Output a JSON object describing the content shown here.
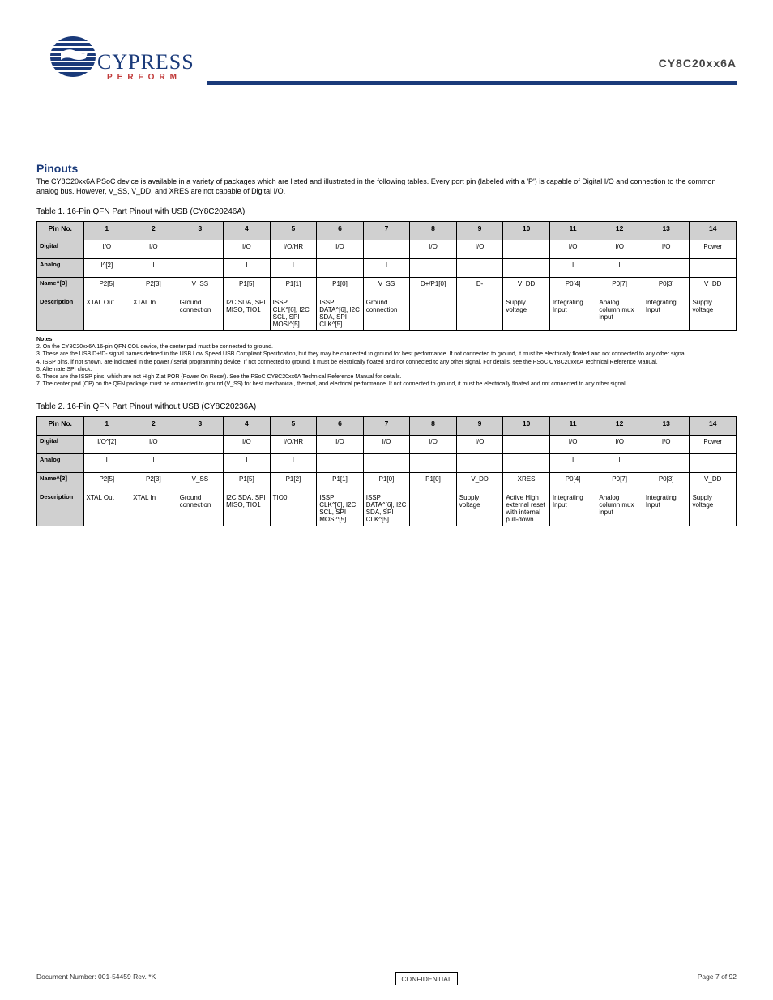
{
  "header": {
    "brand": "CYPRESS",
    "tagline": "PERFORM",
    "part": "CY8C20xx6A"
  },
  "section": {
    "title": "Pinouts",
    "sub": "The CY8C20xx6A PSoC device is available in a variety of packages which are listed and illustrated in the following tables. Every port pin (labeled with a 'P') is capable of Digital I/O and connection to the common analog bus. However, V_SS, V_DD, and XRES are not capable of Digital I/O."
  },
  "tables": [
    {
      "idx": 1,
      "caption": "Table 1.  16-Pin QFN Part Pinout with USB (CY8C20246A)",
      "cols": [
        "Pin No.",
        "1",
        "2",
        "3",
        "4",
        "5",
        "6",
        "7",
        "8",
        "9",
        "10",
        "11",
        "12",
        "13",
        "14"
      ],
      "rows": [
        {
          "hdr": "Digital",
          "cells": [
            "I/O",
            "I/O",
            "",
            "I/O",
            "I/O/HR",
            "I/O",
            "",
            "I/O",
            "I/O",
            "",
            "I/O",
            "I/O",
            "I/O",
            "Power"
          ]
        },
        {
          "hdr": "Analog",
          "cells": [
            "I^[2]",
            "I",
            "",
            "I",
            "I",
            "I",
            "I",
            "",
            "",
            "",
            "I",
            "I",
            "",
            ""
          ]
        },
        {
          "hdr": "Name^[3]",
          "cells": [
            "P2[5]",
            "P2[3]",
            "V_SS",
            "P1[5]",
            "P1[1]",
            "P1[0]",
            "V_SS",
            "D+/P1[0]",
            "D-",
            "V_DD",
            "P0[4]",
            "P0[7]",
            "P0[3]",
            "V_DD"
          ]
        },
        {
          "hdr": "Description",
          "left": true,
          "cells": [
            "XTAL Out",
            "XTAL In",
            "Ground connection",
            "I2C SDA, SPI MISO, TIO1",
            "ISSP CLK^[6], I2C SCL, SPI MOSI^[5]",
            "ISSP DATA^[6], I2C SDA, SPI CLK^[5]",
            "Ground connection",
            "",
            "",
            "Supply voltage",
            "Integrating Input",
            "Analog column mux input",
            "Integrating Input",
            "Supply voltage"
          ]
        }
      ],
      "footnotes": [
        "2. On the CY8C20xx6A 16-pin QFN COL device, the center pad must be connected to ground.",
        "3. These are the USB D+/D- signal names defined in the USB Low Speed USB Compliant Specification, but they may be connected to ground for best performance. If not connected to ground, it must be electrically floated and not connected to any other signal.",
        "4. ISSP pins, if not shown, are indicated in the power / serial programming device. If not connected to ground, it must be electrically floated and not connected to any other signal. For details, see the PSoC CY8C20xx6A Technical Reference Manual.",
        "5. Alternate SPI clock.",
        "6. These are the ISSP pins, which are not High Z at POR (Power On Reset). See the PSoC CY8C20xx6A Technical Reference Manual for details.",
        "7. The center pad (CP) on the QFN package must be connected to ground (V_SS) for best mechanical, thermal, and electrical performance. If not connected to ground, it must be electrically floated and not connected to any other signal."
      ]
    },
    {
      "idx": 2,
      "caption": "Table 2.  16-Pin QFN Part Pinout without USB (CY8C20236A)",
      "cols": [
        "Pin No.",
        "1",
        "2",
        "3",
        "4",
        "5",
        "6",
        "7",
        "8",
        "9",
        "10",
        "11",
        "12",
        "13",
        "14"
      ],
      "rows": [
        {
          "hdr": "Digital",
          "cells": [
            "I/O^[2]",
            "I/O",
            "",
            "I/O",
            "I/O/HR",
            "I/O",
            "I/O",
            "I/O",
            "I/O",
            "",
            "I/O",
            "I/O",
            "I/O",
            "Power"
          ]
        },
        {
          "hdr": "Analog",
          "cells": [
            "I",
            "I",
            "",
            "I",
            "I",
            "I",
            "",
            "",
            "",
            "",
            "I",
            "I",
            "",
            ""
          ]
        },
        {
          "hdr": "Name^[3]",
          "cells": [
            "P2[5]",
            "P2[3]",
            "V_SS",
            "P1[5]",
            "P1[2]",
            "P1[1]",
            "P1[0]",
            "P1[0]",
            "V_DD",
            "XRES",
            "P0[4]",
            "P0[7]",
            "P0[3]",
            "V_DD"
          ]
        },
        {
          "hdr": "Description",
          "left": true,
          "cells": [
            "XTAL Out",
            "XTAL In",
            "Ground connection",
            "I2C SDA, SPI MISO, TIO1",
            "TIO0",
            "ISSP CLK^[6], I2C SCL, SPI MOSI^[5]",
            "ISSP DATA^[6], I2C SDA, SPI CLK^[5]",
            "",
            "Supply voltage",
            "Active High external reset with internal pull-down",
            "Integrating Input",
            "Analog column mux input",
            "Integrating Input",
            "Supply voltage"
          ]
        }
      ]
    }
  ],
  "chart_data": [
    {
      "type": "table",
      "title": "16-Pin QFN Part Pinout with USB (CY8C20246A)",
      "columns": [
        "Pin No.",
        "Digital",
        "Analog",
        "Name",
        "Description"
      ],
      "rows": [
        [
          "1",
          "I/O",
          "I",
          "P2[5]",
          "XTAL Out"
        ],
        [
          "2",
          "I/O",
          "I",
          "P2[3]",
          "XTAL In"
        ],
        [
          "3",
          "",
          "",
          "V_SS",
          "Ground connection"
        ],
        [
          "4",
          "I/O",
          "I",
          "P1[5]",
          "I2C SDA, SPI MISO, TIO1"
        ],
        [
          "5",
          "I/O/HR",
          "I",
          "P1[1]",
          "ISSP CLK, I2C SCL, SPI MOSI"
        ],
        [
          "6",
          "I/O",
          "I",
          "P1[0]",
          "ISSP DATA, I2C SDA, SPI CLK"
        ],
        [
          "7",
          "",
          "I",
          "V_SS",
          "Ground connection"
        ],
        [
          "8",
          "I/O",
          "",
          "D+/P1[0]",
          ""
        ],
        [
          "9",
          "I/O",
          "",
          "D-",
          ""
        ],
        [
          "10",
          "",
          "",
          "V_DD",
          "Supply voltage"
        ],
        [
          "11",
          "I/O",
          "I",
          "P0[4]",
          "Integrating Input"
        ],
        [
          "12",
          "I/O",
          "I",
          "P0[7]",
          "Analog column mux input"
        ],
        [
          "13",
          "I/O",
          "",
          "P0[3]",
          "Integrating Input"
        ],
        [
          "14",
          "Power",
          "",
          "V_DD",
          "Supply voltage"
        ]
      ]
    },
    {
      "type": "table",
      "title": "16-Pin QFN Part Pinout without USB (CY8C20236A)",
      "columns": [
        "Pin No.",
        "Digital",
        "Analog",
        "Name",
        "Description"
      ],
      "rows": [
        [
          "1",
          "I/O",
          "I",
          "P2[5]",
          "XTAL Out"
        ],
        [
          "2",
          "I/O",
          "I",
          "P2[3]",
          "XTAL In"
        ],
        [
          "3",
          "",
          "",
          "V_SS",
          "Ground connection"
        ],
        [
          "4",
          "I/O",
          "I",
          "P1[5]",
          "I2C SDA, SPI MISO, TIO1"
        ],
        [
          "5",
          "I/O/HR",
          "I",
          "P1[2]",
          "TIO0"
        ],
        [
          "6",
          "I/O",
          "I",
          "P1[1]",
          "ISSP CLK, I2C SCL, SPI MOSI"
        ],
        [
          "7",
          "I/O",
          "",
          "P1[0]",
          "ISSP DATA, I2C SDA, SPI CLK"
        ],
        [
          "8",
          "I/O",
          "",
          "P1[0]",
          ""
        ],
        [
          "9",
          "I/O",
          "",
          "V_DD",
          "Supply voltage"
        ],
        [
          "10",
          "",
          "",
          "XRES",
          "Active High external reset with internal pull-down"
        ],
        [
          "11",
          "I/O",
          "I",
          "P0[4]",
          "Integrating Input"
        ],
        [
          "12",
          "I/O",
          "I",
          "P0[7]",
          "Analog column mux input"
        ],
        [
          "13",
          "I/O",
          "",
          "P0[3]",
          "Integrating Input"
        ],
        [
          "14",
          "Power",
          "",
          "V_DD",
          "Supply voltage"
        ]
      ]
    }
  ],
  "footer": {
    "left": "Document Number: 001-54459 Rev. *K",
    "center": "CONFIDENTIAL",
    "right": "Page 7 of 92"
  }
}
